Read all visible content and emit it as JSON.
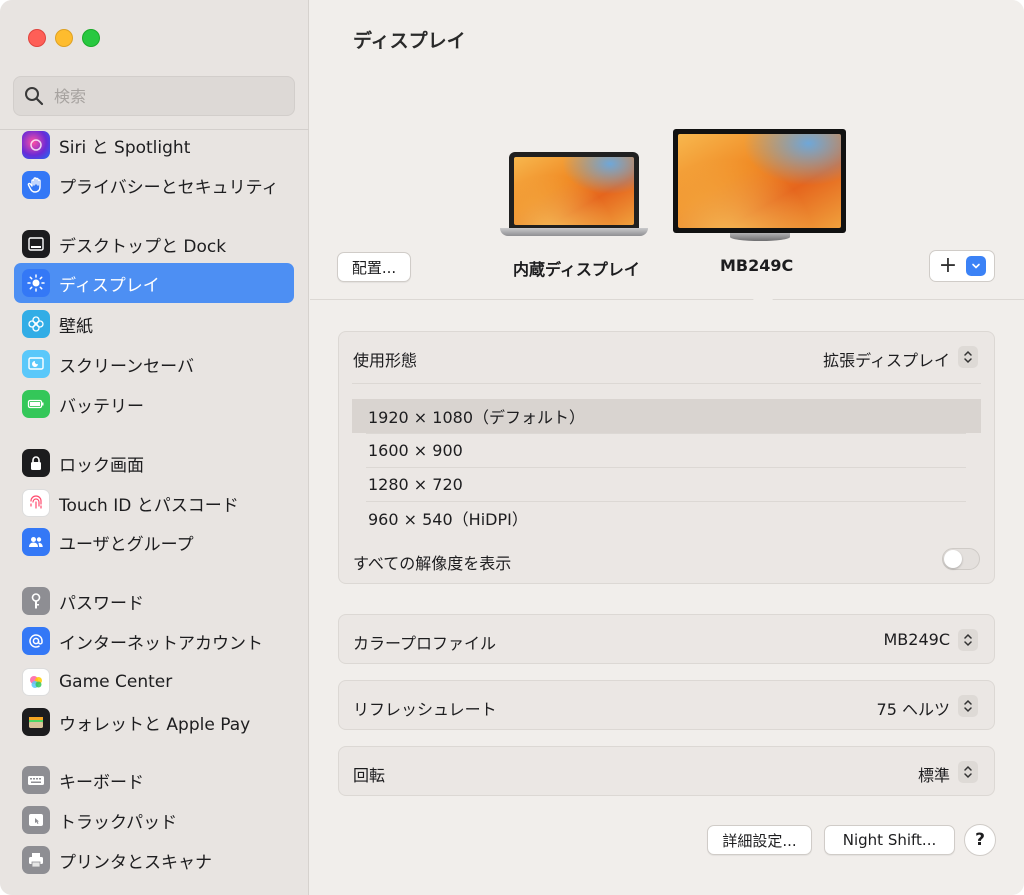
{
  "window": {
    "title": "ディスプレイ"
  },
  "sidebar": {
    "search": {
      "placeholder": "検索",
      "icon": "search-icon"
    },
    "items": [
      {
        "label": "Siri と Spotlight",
        "icon": "siri-icon",
        "color": "#7a3cd6"
      },
      {
        "label": "プライバシーとセキュリティ",
        "icon": "hand-icon",
        "color": "#3478f6"
      },
      {
        "label": "デスクトップと Dock",
        "icon": "dock-icon",
        "color": "#1c1c1e"
      },
      {
        "label": "ディスプレイ",
        "icon": "sun-icon",
        "color": "#3478f6",
        "active": true
      },
      {
        "label": "壁紙",
        "icon": "flower-icon",
        "color": "#32ade6"
      },
      {
        "label": "スクリーンセーバ",
        "icon": "screensaver-icon",
        "color": "#5ac8fa"
      },
      {
        "label": "バッテリー",
        "icon": "battery-icon",
        "color": "#34c759"
      },
      {
        "label": "ロック画面",
        "icon": "lock-icon",
        "color": "#1c1c1e"
      },
      {
        "label": "Touch ID とパスコード",
        "icon": "fingerprint-icon",
        "color": "#ff5a5f"
      },
      {
        "label": "ユーザとグループ",
        "icon": "users-icon",
        "color": "#3478f6"
      },
      {
        "label": "パスワード",
        "icon": "key-icon",
        "color": "#8e8e93"
      },
      {
        "label": "インターネットアカウント",
        "icon": "at-icon",
        "color": "#3478f6"
      },
      {
        "label": "Game Center",
        "icon": "gamecenter-icon",
        "color": "#ffffff"
      },
      {
        "label": "ウォレットと Apple Pay",
        "icon": "wallet-icon",
        "color": "#1c1c1e"
      },
      {
        "label": "キーボード",
        "icon": "keyboard-icon",
        "color": "#8e8e93"
      },
      {
        "label": "トラックパッド",
        "icon": "trackpad-icon",
        "color": "#8e8e93"
      },
      {
        "label": "プリンタとスキャナ",
        "icon": "printer-icon",
        "color": "#8e8e93"
      }
    ]
  },
  "arrange": {
    "button_label": "配置...",
    "displays": [
      {
        "name": "内蔵ディスプレイ"
      },
      {
        "name": "MB249C",
        "selected": true
      }
    ],
    "add_label": "+"
  },
  "usage": {
    "label": "使用形態",
    "value": "拡張ディスプレイ"
  },
  "resolutions": [
    {
      "label": "1920 × 1080（デフォルト）",
      "selected": true
    },
    {
      "label": "1600 × 900"
    },
    {
      "label": "1280 × 720"
    },
    {
      "label": "960 × 540（HiDPI）"
    }
  ],
  "show_all": {
    "label": "すべての解像度を表示",
    "on": false
  },
  "color_profile": {
    "label": "カラープロファイル",
    "value": "MB249C"
  },
  "refresh_rate": {
    "label": "リフレッシュレート",
    "value": "75 ヘルツ"
  },
  "rotation": {
    "label": "回転",
    "value": "標準"
  },
  "footer": {
    "advanced_label": "詳細設定...",
    "night_shift_label": "Night Shift...",
    "help_label": "?"
  },
  "colors": {
    "accent": "#4d8ff3",
    "sidebar_bg": "#e8e4e1",
    "panel_bg": "#ebe7e4"
  }
}
